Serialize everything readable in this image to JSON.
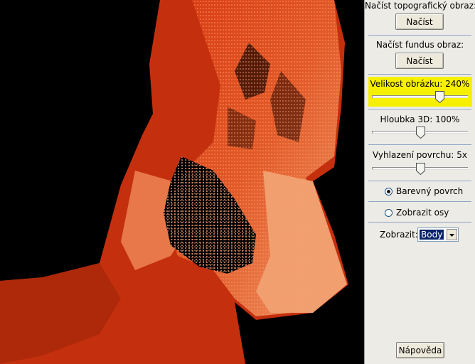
{
  "panel": {
    "topo_label": "Načíst topografický obraz:",
    "topo_button": "Načíst",
    "fundus_label": "Načíst fundus obraz:",
    "fundus_button": "Načíst",
    "size_label": "Velikost obrázku:",
    "size_value": "240%",
    "size_slider_fraction": 0.72,
    "depth_label": "Hloubka 3D:",
    "depth_value": "100%",
    "depth_slider_fraction": 0.5,
    "smooth_label": "Vyhlazení povrchu:",
    "smooth_value": "5x",
    "smooth_slider_fraction": 0.5,
    "radio_color_label": "Barevný povrch",
    "radio_color_checked": true,
    "radio_axes_label": "Zobrazit osy",
    "radio_axes_checked": false,
    "show_label": "Zobrazit:",
    "show_value": "Body",
    "help_button": "Nápověda"
  },
  "colors": {
    "highlight": "#f6f000",
    "surface_deep": "#c8300f",
    "surface_mid": "#e0602a",
    "surface_light": "#f0a070",
    "panel_bg": "#ecebe6"
  },
  "icons": {
    "slider_thumb": "slider-thumb-icon",
    "dropdown_arrow": "chevron-down-icon"
  }
}
